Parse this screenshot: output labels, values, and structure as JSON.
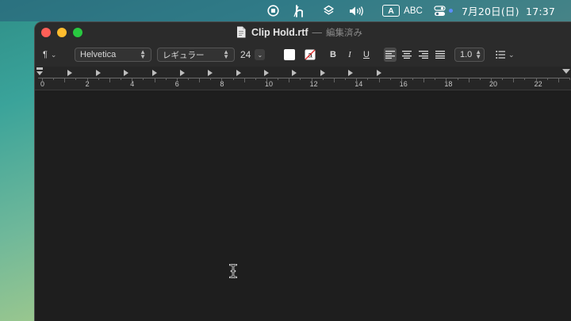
{
  "menubar": {
    "icons": [
      "screen-record-icon",
      "h-app-icon",
      "layers-app-icon",
      "volume-icon",
      "control-center-icon"
    ],
    "input_source_badge": "A",
    "input_source_label": "ABC",
    "datetime": "7月20日(日)  17:37"
  },
  "window": {
    "title": "Clip Hold.rtf",
    "title_separator": "—",
    "status": "編集済み"
  },
  "toolbar": {
    "paragraph_style": "¶",
    "font_family": "Helvetica",
    "font_style": "レギュラー",
    "font_size": "24",
    "bold_label": "B",
    "italic_label": "I",
    "underline_label": "U",
    "line_spacing": "1.0"
  },
  "ruler": {
    "labels": [
      "0",
      "2",
      "4",
      "6",
      "8",
      "10",
      "12",
      "14",
      "16",
      "18",
      "20",
      "22"
    ]
  },
  "colors": {
    "window_bg": "#1e1e1e",
    "toolbar_bg": "#2b2b2b",
    "close": "#ff5f57",
    "minimize": "#febc2e",
    "zoom": "#28c840"
  }
}
